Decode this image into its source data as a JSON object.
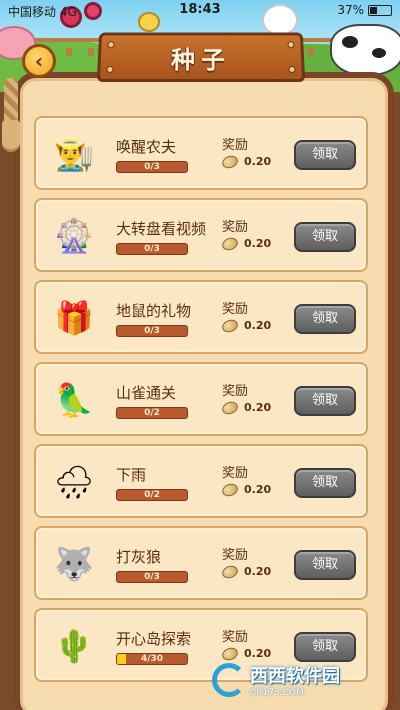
{
  "status_bar": {
    "carrier": "中国移动 4G",
    "time": "18:43",
    "battery": "37%",
    "battery_level": 0.37
  },
  "header": {
    "title": "种子",
    "back_icon": "back-arrow-icon"
  },
  "tasks": [
    {
      "name": "唤醒农夫",
      "progress": "0/3",
      "progress_fraction": 0,
      "reward_label": "奖励",
      "reward_value": "0.20",
      "button": "领取",
      "icon": "farmer-icon",
      "glyph": "👨‍🌾"
    },
    {
      "name": "大转盘看视频",
      "progress": "0/3",
      "progress_fraction": 0,
      "reward_label": "奖励",
      "reward_value": "0.20",
      "button": "领取",
      "icon": "spin-wheel-icon",
      "glyph": "🎡"
    },
    {
      "name": "地鼠的礼物",
      "progress": "0/3",
      "progress_fraction": 0,
      "reward_label": "奖励",
      "reward_value": "0.20",
      "button": "领取",
      "icon": "gopher-gift-icon",
      "glyph": "🎁"
    },
    {
      "name": "山雀通关",
      "progress": "0/2",
      "progress_fraction": 0,
      "reward_label": "奖励",
      "reward_value": "0.20",
      "button": "领取",
      "icon": "parrot-icon",
      "glyph": "🦜"
    },
    {
      "name": "下雨",
      "progress": "0/2",
      "progress_fraction": 0,
      "reward_label": "奖励",
      "reward_value": "0.20",
      "button": "领取",
      "icon": "rain-cloud-icon",
      "glyph": "🌧"
    },
    {
      "name": "打灰狼",
      "progress": "0/3",
      "progress_fraction": 0,
      "reward_label": "奖励",
      "reward_value": "0.20",
      "button": "领取",
      "icon": "wolf-icon",
      "glyph": "🐺"
    },
    {
      "name": "开心岛探索",
      "progress": "4/30",
      "progress_fraction": 0.1333,
      "reward_label": "奖励",
      "reward_value": "0.20",
      "button": "领取",
      "icon": "cactus-island-icon",
      "glyph": "🌵"
    }
  ],
  "watermark": {
    "main": "西西软件园",
    "sub": "CR173.COM"
  },
  "colors": {
    "panel": "#f6dcae",
    "wood": "#7b4426",
    "button_disabled": "#6e6e6e",
    "progress_bg": "#b85a2e",
    "progress_fill": "#f6d01c"
  }
}
